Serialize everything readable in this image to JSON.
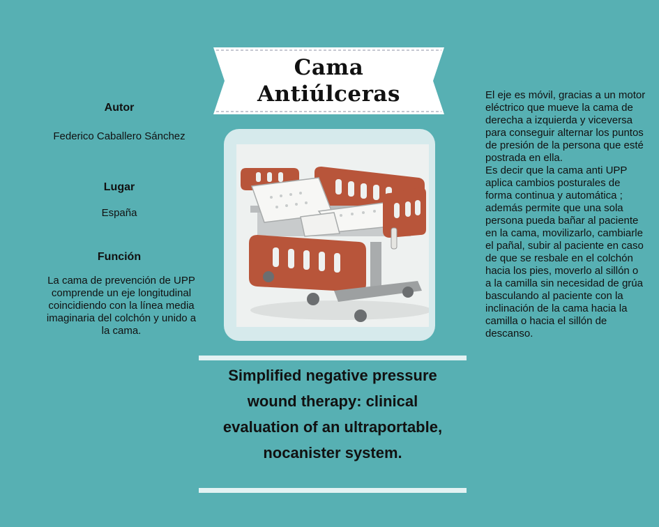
{
  "title": {
    "line1": "Cama",
    "line2": "Antiúlceras"
  },
  "autor": {
    "label": "Autor",
    "value": "Federico Caballero Sánchez"
  },
  "lugar": {
    "label": "Lugar",
    "value": "España"
  },
  "funcion": {
    "label": "Función",
    "value": "La cama de prevención de UPP comprende un eje longitudinal coincidiendo con la línea media imaginaria del colchón y unido a la cama."
  },
  "description": {
    "p1": "El eje es móvil, gracias a un motor eléctrico que mueve la cama de derecha a izquierda y viceversa para conseguir alternar los puntos de presión de la persona que esté postrada en ella.",
    "p2": "Es decir que la cama anti UPP aplica cambios posturales de forma continua y automática ; además permite que una sola persona pueda bañar al paciente en la cama, movilizarlo, cambiarle el pañal, subir al paciente en caso de que se resbale en el colchón hacia los pies, moverlo al sillón o a la camilla sin necesidad de grúa basculando al paciente con la inclinación de la cama hacia la camilla o hacia el sillón de descanso."
  },
  "reference": "Simplified negative pressure wound therapy: clinical evaluation of an ultraportable, nocanister system.",
  "colors": {
    "background": "#57b0b3",
    "banner": "#ffffff",
    "bed_panel": "#b8553a",
    "card": "#d6eaec"
  }
}
